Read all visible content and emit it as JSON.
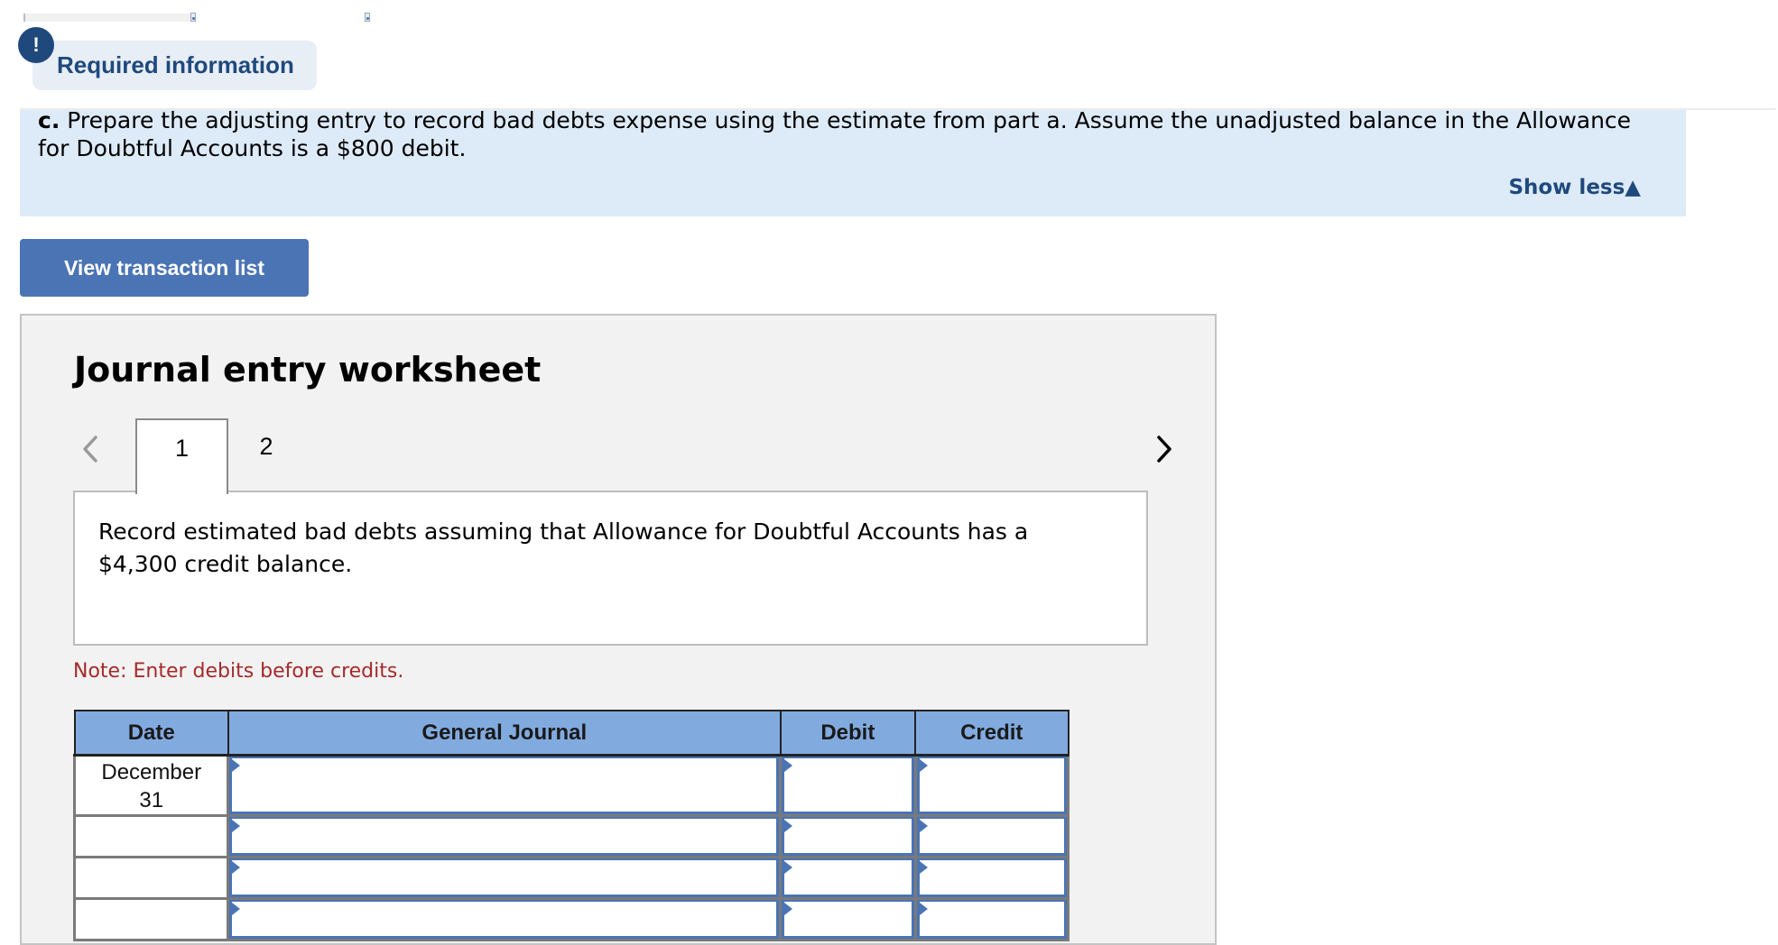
{
  "header": {
    "required_info_badge": "!",
    "required_info_label": "Required information"
  },
  "question": {
    "part_label": "c.",
    "text": "Prepare the adjusting entry to record bad debts expense using the estimate from part a. Assume the unadjusted balance in the Allowance for Doubtful Accounts is a $800 debit.",
    "toggle_label": "Show less",
    "toggle_icon": "▲"
  },
  "view_transaction_button": "View transaction list",
  "worksheet": {
    "title": "Journal entry worksheet",
    "tabs": [
      {
        "label": "1",
        "active": true
      },
      {
        "label": "2",
        "active": false
      }
    ],
    "instruction": "Record estimated bad debts assuming that Allowance for Doubtful Accounts has a $4,300 credit balance.",
    "note": "Note: Enter debits before credits.",
    "table": {
      "columns": [
        "Date",
        "General Journal",
        "Debit",
        "Credit"
      ],
      "rows": [
        {
          "date": "December\n31",
          "date_line1": "December",
          "date_line2": "31",
          "account": "",
          "debit": "",
          "credit": ""
        },
        {
          "date": "",
          "account": "",
          "debit": "",
          "credit": ""
        },
        {
          "date": "",
          "account": "",
          "debit": "",
          "credit": ""
        },
        {
          "date": "",
          "account": "",
          "debit": "",
          "credit": ""
        }
      ]
    }
  },
  "colors": {
    "brand_dark_blue": "#1f497d",
    "button_blue": "#4a74b4",
    "question_band": "#ddeaf7",
    "table_header": "#81aadf",
    "note_red": "#a52a2a"
  }
}
